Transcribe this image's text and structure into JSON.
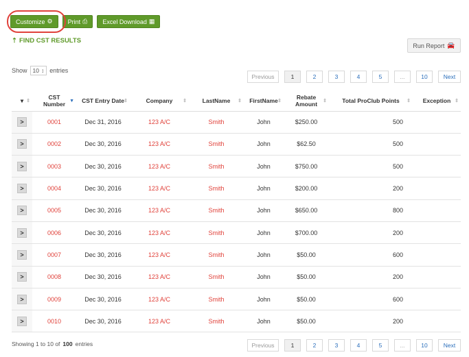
{
  "toolbar": {
    "customize_label": "Customize",
    "print_label": "Print",
    "excel_label": "Excel Download"
  },
  "find_link": "FIND CST RESULTS",
  "run_report_label": "Run Report",
  "show_entries": {
    "show": "Show",
    "value": "10",
    "entries": "entries"
  },
  "pager": {
    "previous": "Previous",
    "pages": [
      "1",
      "2",
      "3",
      "4",
      "5",
      "...",
      "10"
    ],
    "next": "Next"
  },
  "columns": [
    "CST Number",
    "CST Entry Date",
    "Company",
    "LastName",
    "FirstName",
    "Rebate Amount",
    "Total ProClub Points",
    "Exception"
  ],
  "rows": [
    {
      "cst": "0001",
      "date": "Dec 31, 2016",
      "company": "123 A/C",
      "last": "Smith",
      "first": "John",
      "rebate": "$250.00",
      "points": "500",
      "exception": ""
    },
    {
      "cst": "0002",
      "date": "Dec 30, 2016",
      "company": "123 A/C",
      "last": "Smith",
      "first": "John",
      "rebate": "$62.50",
      "points": "500",
      "exception": ""
    },
    {
      "cst": "0003",
      "date": "Dec 30, 2016",
      "company": "123 A/C",
      "last": "Smith",
      "first": "John",
      "rebate": "$750.00",
      "points": "500",
      "exception": ""
    },
    {
      "cst": "0004",
      "date": "Dec 30, 2016",
      "company": "123 A/C",
      "last": "Smith",
      "first": "John",
      "rebate": "$200.00",
      "points": "200",
      "exception": ""
    },
    {
      "cst": "0005",
      "date": "Dec 30, 2016",
      "company": "123 A/C",
      "last": "Smith",
      "first": "John",
      "rebate": "$650.00",
      "points": "800",
      "exception": ""
    },
    {
      "cst": "0006",
      "date": "Dec 30, 2016",
      "company": "123 A/C",
      "last": "Smith",
      "first": "John",
      "rebate": "$700.00",
      "points": "200",
      "exception": ""
    },
    {
      "cst": "0007",
      "date": "Dec 30, 2016",
      "company": "123 A/C",
      "last": "Smith",
      "first": "John",
      "rebate": "$50.00",
      "points": "600",
      "exception": ""
    },
    {
      "cst": "0008",
      "date": "Dec 30, 2016",
      "company": "123 A/C",
      "last": "Smith",
      "first": "John",
      "rebate": "$50.00",
      "points": "200",
      "exception": ""
    },
    {
      "cst": "0009",
      "date": "Dec 30, 2016",
      "company": "123 A/C",
      "last": "Smith",
      "first": "John",
      "rebate": "$50.00",
      "points": "600",
      "exception": ""
    },
    {
      "cst": "0010",
      "date": "Dec 30, 2016",
      "company": "123 A/C",
      "last": "Smith",
      "first": "John",
      "rebate": "$50.00",
      "points": "200",
      "exception": ""
    }
  ],
  "footer": {
    "prefix": "Showing 1 to 10 of",
    "total": "100",
    "suffix": "entries"
  },
  "colors": {
    "brand_green": "#5f9a2a",
    "accent_red": "#e0413a",
    "link_blue": "#2a6ebb"
  }
}
